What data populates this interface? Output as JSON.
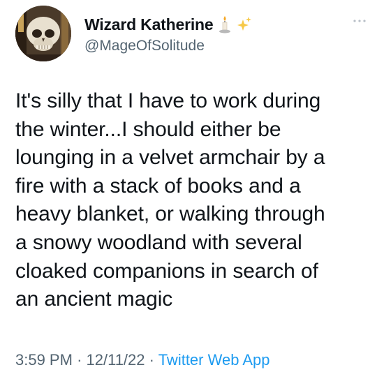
{
  "author": {
    "display_name": "Wizard Katherine",
    "emojis": [
      "candle-icon",
      "sparkles-icon"
    ],
    "handle": "@MageOfSolitude"
  },
  "tweet": {
    "text": "It's silly that I have to work during\nthe winter...I should either be\nlounging in a velvet armchair by a\nfire with a stack of books and a\nheavy blanket, or walking through\na snowy woodland with several\ncloaked companions in search of\nan ancient magic"
  },
  "meta": {
    "time": "3:59 PM",
    "separator": "·",
    "date": "12/11/22",
    "source": "Twitter Web App"
  },
  "colors": {
    "text": "#0f1419",
    "secondary": "#536471",
    "link": "#1d9bf0"
  }
}
